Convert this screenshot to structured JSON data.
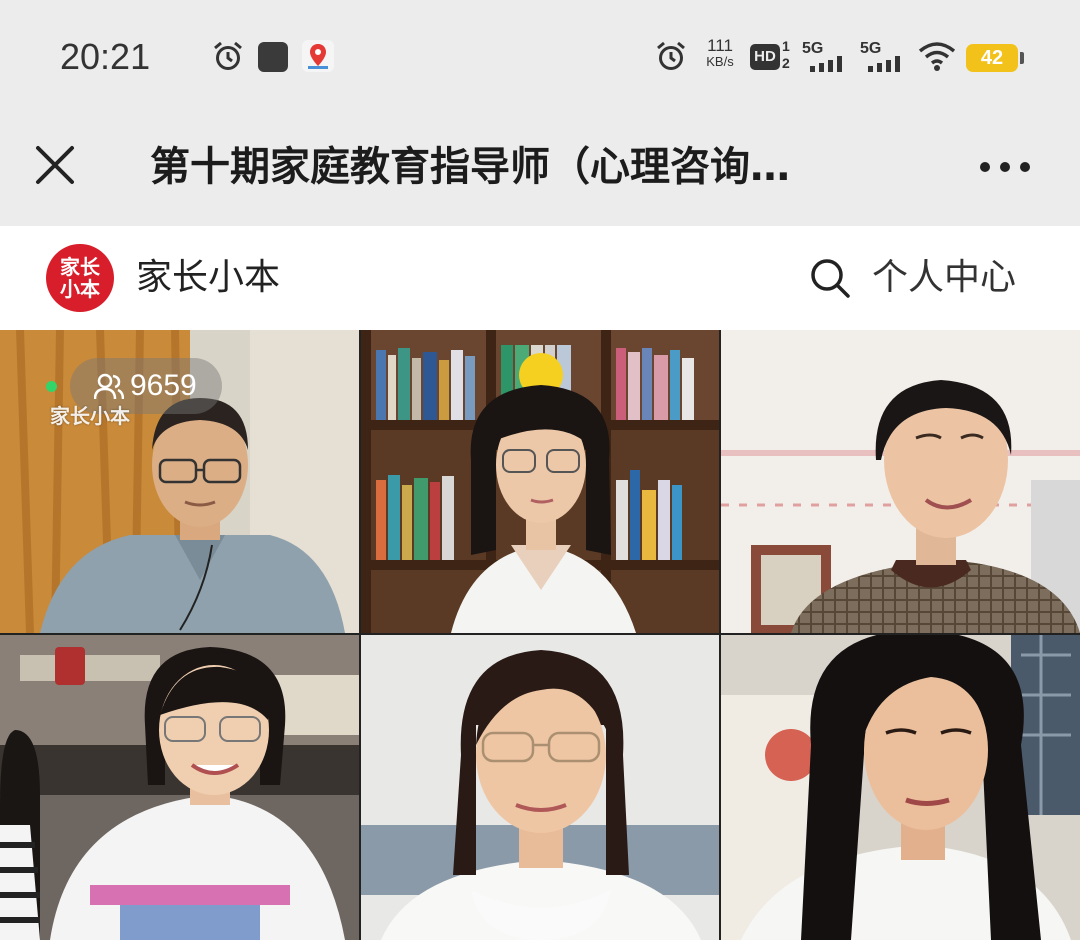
{
  "status_bar": {
    "time": "20:21",
    "net_speed_value": "111",
    "net_speed_unit": "KB/s",
    "hd_label": "HD",
    "hd_sims": "1\n2",
    "sig1_label": "5G",
    "sig2_label": "5G",
    "battery_level": "42",
    "battery_color": "#f2c21b"
  },
  "title_bar": {
    "title": "第十期家庭教育指导师（心理咨询…",
    "close_icon": "close-icon",
    "more_icon": "more-dots-icon"
  },
  "app_header": {
    "logo_text": "家长小本",
    "app_name": "家长小本",
    "profile_label": "个人中心",
    "brand_color": "#d81e2a"
  },
  "video_grid": {
    "viewer_count": "9659",
    "watermark": "家长小本",
    "tiles": [
      {
        "participant": "participant-1"
      },
      {
        "participant": "participant-2"
      },
      {
        "participant": "participant-3"
      },
      {
        "participant": "participant-4"
      },
      {
        "participant": "participant-5"
      },
      {
        "participant": "participant-6"
      }
    ]
  }
}
